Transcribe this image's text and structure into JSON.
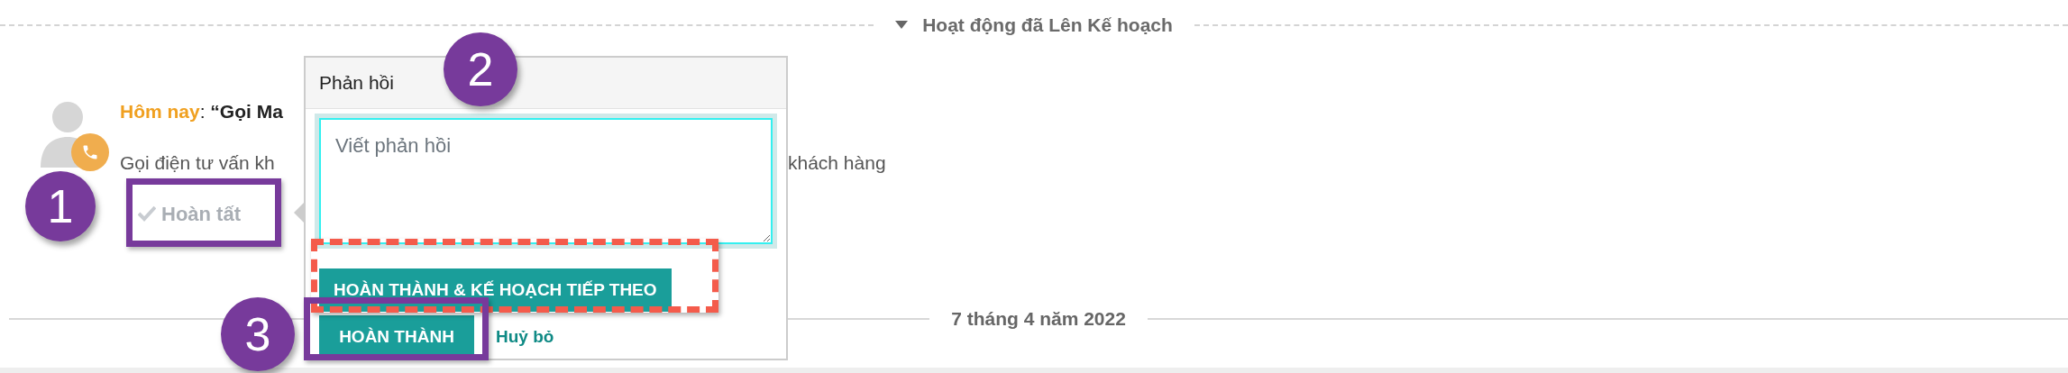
{
  "section_header": {
    "label": "Hoạt động đã Lên Kế hoạch",
    "expanded": true
  },
  "activity": {
    "day": "Hôm nay",
    "title": ": **“Gọi Ma**",
    "description_start": "Gọi điện tư vấn kh",
    "description_end": "khách hàng",
    "done_button": "Hoàn tất"
  },
  "feedback_popover": {
    "title": "Phản hồi",
    "placeholder": "Viết phản hồi",
    "buttons": [
      {
        "label": "HOÀN THÀNH & KẾ HOẠCH TIẾP THEO",
        "kind": "primary"
      },
      {
        "label": "HOÀN THÀNH",
        "kind": "primary"
      },
      {
        "label": "Huỷ bỏ",
        "kind": "link"
      }
    ]
  },
  "date_divider": "7 tháng 4 năm 2022",
  "step_markers": [
    {
      "label": "1"
    },
    {
      "label": "2"
    },
    {
      "label": "3"
    }
  ],
  "highlights": [
    {
      "kind": "solid",
      "color": "#773a9b"
    },
    {
      "kind": "dashed",
      "color": "#f45b4b"
    },
    {
      "kind": "solid",
      "color": "#773a9b"
    }
  ]
}
